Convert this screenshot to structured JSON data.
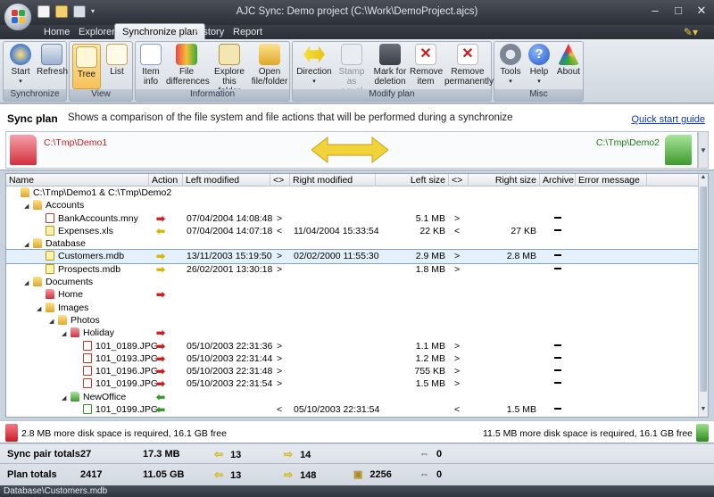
{
  "window": {
    "title": "AJC Sync: Demo project (C:\\Work\\DemoProject.ajcs)"
  },
  "tabs": [
    {
      "label": "Home"
    },
    {
      "label": "Explorer"
    },
    {
      "label": "Synchronize plan"
    },
    {
      "label": "History"
    },
    {
      "label": "Report"
    }
  ],
  "ribbon": {
    "groups": {
      "synchronize": "Synchronize",
      "view": "View",
      "information": "Information",
      "modify_plan": "Modify plan",
      "misc": "Misc"
    },
    "buttons": {
      "start": "Start",
      "refresh": "Refresh",
      "tree": "Tree",
      "list": "List",
      "item_info": [
        "Item",
        "info"
      ],
      "file_differences": [
        "File",
        "differences"
      ],
      "explore_folder": [
        "Explore",
        "this folder"
      ],
      "open_file": [
        "Open",
        "file/folder"
      ],
      "direction": "Direction",
      "stamp_equal": [
        "Stamp as",
        "equal"
      ],
      "mark_deletion": [
        "Mark for",
        "deletion"
      ],
      "remove_item": [
        "Remove",
        "item"
      ],
      "remove_perm": [
        "Remove",
        "permanently"
      ],
      "tools": "Tools",
      "help": "Help",
      "about": "About"
    }
  },
  "info": {
    "title": "Sync plan",
    "description": "Shows a comparison of the file system and file actions that will be performed during a synchronize",
    "quick_start": "Quick start guide",
    "left_path": "C:\\Tmp\\Demo1",
    "right_path": "C:\\Tmp\\Demo2"
  },
  "columns": [
    "Name",
    "Action",
    "Left modified",
    "<>",
    "Right modified",
    "Left size",
    "<>",
    "Right size",
    "Archive",
    "Error message"
  ],
  "rows": [
    {
      "name": "C:\\Tmp\\Demo1 & C:\\Tmp\\Demo2",
      "indent": 0,
      "icon": "folder",
      "tw": "",
      "action": "",
      "lmod": "",
      "lcmp": "",
      "rmod": "",
      "lsize": "",
      "scmp": "",
      "rsize": "",
      "archive": "",
      "error": ""
    },
    {
      "name": "Accounts",
      "indent": 1,
      "icon": "folder",
      "tw": "◢",
      "action": "",
      "lmod": "",
      "lcmp": "",
      "rmod": "",
      "lsize": "",
      "scmp": "",
      "rsize": "",
      "archive": "",
      "error": ""
    },
    {
      "name": "BankAccounts.mny",
      "indent": 2,
      "icon": "file",
      "tw": "",
      "action": "right",
      "lmod": "07/04/2004 14:08:48",
      "lcmp": ">",
      "rmod": "",
      "lsize": "5.1 MB",
      "scmp": ">",
      "rsize": "",
      "archive": "-",
      "error": ""
    },
    {
      "name": "Expenses.xls",
      "indent": 2,
      "icon": "filey",
      "tw": "",
      "action": "left",
      "lmod": "07/04/2004 14:07:18",
      "lcmp": "<",
      "rmod": "11/04/2004 15:33:54",
      "lsize": "22 KB",
      "scmp": "<",
      "rsize": "27 KB",
      "archive": "-",
      "error": ""
    },
    {
      "name": "Database",
      "indent": 1,
      "icon": "folder",
      "tw": "◢",
      "action": "",
      "lmod": "",
      "lcmp": "",
      "rmod": "",
      "lsize": "",
      "scmp": "",
      "rsize": "",
      "archive": "",
      "error": ""
    },
    {
      "name": "Customers.mdb",
      "indent": 2,
      "icon": "filey",
      "tw": "",
      "action": "right-y",
      "lmod": "13/11/2003 15:19:50",
      "lcmp": ">",
      "rmod": "02/02/2000 11:55:30",
      "lsize": "2.9 MB",
      "scmp": ">",
      "rsize": "2.8 MB",
      "archive": "-",
      "error": "",
      "selected": true
    },
    {
      "name": "Prospects.mdb",
      "indent": 2,
      "icon": "filey",
      "tw": "",
      "action": "right-y",
      "lmod": "26/02/2001 13:30:18",
      "lcmp": ">",
      "rmod": "",
      "lsize": "1.8 MB",
      "scmp": ">",
      "rsize": "",
      "archive": "-",
      "error": ""
    },
    {
      "name": "Documents",
      "indent": 1,
      "icon": "folder",
      "tw": "◢",
      "action": "",
      "lmod": "",
      "lcmp": "",
      "rmod": "",
      "lsize": "",
      "scmp": "",
      "rsize": "",
      "archive": "",
      "error": ""
    },
    {
      "name": "Home",
      "indent": 2,
      "icon": "foldr",
      "tw": "",
      "action": "right",
      "lmod": "",
      "lcmp": "",
      "rmod": "",
      "lsize": "",
      "scmp": "",
      "rsize": "",
      "archive": "",
      "error": ""
    },
    {
      "name": "Images",
      "indent": 2,
      "icon": "folder",
      "tw": "◢",
      "action": "",
      "lmod": "",
      "lcmp": "",
      "rmod": "",
      "lsize": "",
      "scmp": "",
      "rsize": "",
      "archive": "",
      "error": ""
    },
    {
      "name": "Photos",
      "indent": 3,
      "icon": "folder",
      "tw": "◢",
      "action": "",
      "lmod": "",
      "lcmp": "",
      "rmod": "",
      "lsize": "",
      "scmp": "",
      "rsize": "",
      "archive": "",
      "error": ""
    },
    {
      "name": "Holiday",
      "indent": 4,
      "icon": "foldr",
      "tw": "◢",
      "action": "right",
      "lmod": "",
      "lcmp": "",
      "rmod": "",
      "lsize": "",
      "scmp": "",
      "rsize": "",
      "archive": "",
      "error": ""
    },
    {
      "name": "101_0189.JPG",
      "indent": 5,
      "icon": "file",
      "tw": "",
      "action": "right",
      "lmod": "05/10/2003 22:31:36",
      "lcmp": ">",
      "rmod": "",
      "lsize": "1.1 MB",
      "scmp": ">",
      "rsize": "",
      "archive": "-",
      "error": ""
    },
    {
      "name": "101_0193.JPG",
      "indent": 5,
      "icon": "file",
      "tw": "",
      "action": "right",
      "lmod": "05/10/2003 22:31:44",
      "lcmp": ">",
      "rmod": "",
      "lsize": "1.2 MB",
      "scmp": ">",
      "rsize": "",
      "archive": "-",
      "error": ""
    },
    {
      "name": "101_0196.JPG",
      "indent": 5,
      "icon": "file",
      "tw": "",
      "action": "right",
      "lmod": "05/10/2003 22:31:48",
      "lcmp": ">",
      "rmod": "",
      "lsize": "755 KB",
      "scmp": ">",
      "rsize": "",
      "archive": "-",
      "error": ""
    },
    {
      "name": "101_0199.JPG",
      "indent": 5,
      "icon": "file",
      "tw": "",
      "action": "right",
      "lmod": "05/10/2003 22:31:54",
      "lcmp": ">",
      "rmod": "",
      "lsize": "1.5 MB",
      "scmp": ">",
      "rsize": "",
      "archive": "-",
      "error": ""
    },
    {
      "name": "NewOffice",
      "indent": 4,
      "icon": "foldg",
      "tw": "◢",
      "action": "left-g",
      "lmod": "",
      "lcmp": "",
      "rmod": "",
      "lsize": "",
      "scmp": "",
      "rsize": "",
      "archive": "",
      "error": ""
    },
    {
      "name": "101_0199.JPG",
      "indent": 5,
      "icon": "fileg",
      "tw": "",
      "action": "left-g",
      "lmod": "",
      "lcmp": "<",
      "rmod": "05/10/2003 22:31:54",
      "lsize": "",
      "scmp": "<",
      "rsize": "1.5 MB",
      "archive": "-",
      "error": ""
    }
  ],
  "disk": {
    "left": "2.8 MB more disk space is required, 16.1 GB free",
    "right": "11.5 MB more disk space is required, 16.1 GB free"
  },
  "totals": [
    {
      "label": "Sync pair totals",
      "count": "27",
      "size": "17.3 MB",
      "copy_left": "13",
      "copy_right": "14",
      "stamp": "",
      "delete": "0"
    },
    {
      "label": "Plan totals",
      "count": "2417",
      "size": "11.05 GB",
      "copy_left": "13",
      "copy_right": "148",
      "stamp": "2256",
      "delete": "0"
    }
  ],
  "status": "Database\\Customers.mdb"
}
